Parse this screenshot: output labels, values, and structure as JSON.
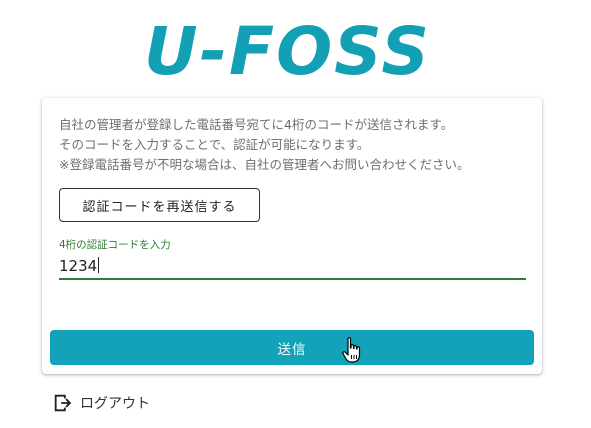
{
  "brand": {
    "logo_text": "U-FOSS",
    "color": "#139fb4"
  },
  "instructions": {
    "line1": "自社の管理者が登録した電話番号宛てに4桁のコードが送信されます。",
    "line2": "そのコードを入力することで、認証が可能になります。",
    "line3": "※登録電話番号が不明な場合は、自社の管理者へお問い合わせください。"
  },
  "resend_button": {
    "label": "認証コードを再送信する"
  },
  "code_field": {
    "label": "4桁の認証コードを入力",
    "value": "1234",
    "accent": "#2e7d32"
  },
  "submit_button": {
    "label": "送信",
    "color": "#13a3b8"
  },
  "logout": {
    "label": "ログアウト",
    "icon": "logout-icon"
  }
}
